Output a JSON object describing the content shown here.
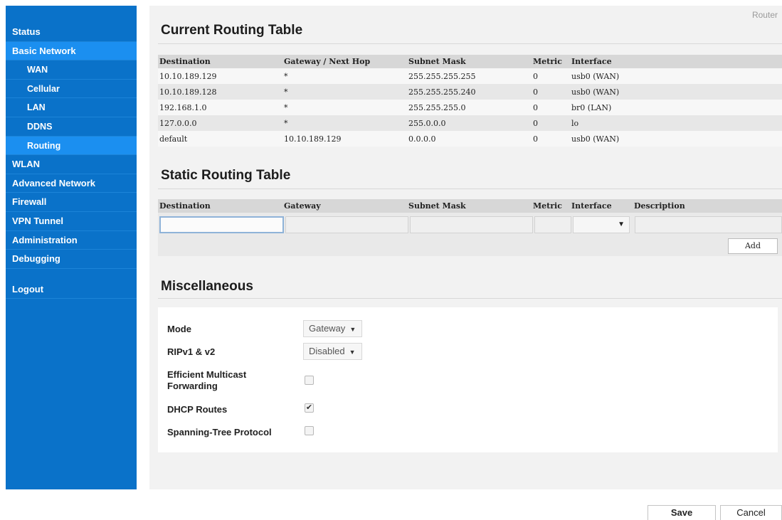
{
  "breadcrumb": "Router",
  "sidebar": {
    "items": [
      {
        "label": "Status"
      },
      {
        "label": "Basic Network"
      },
      {
        "label": "WAN"
      },
      {
        "label": "Cellular"
      },
      {
        "label": "LAN"
      },
      {
        "label": "DDNS"
      },
      {
        "label": "Routing"
      },
      {
        "label": "WLAN"
      },
      {
        "label": "Advanced Network"
      },
      {
        "label": "Firewall"
      },
      {
        "label": "VPN Tunnel"
      },
      {
        "label": "Administration"
      },
      {
        "label": "Debugging"
      },
      {
        "label": "Logout"
      }
    ]
  },
  "current_routing": {
    "title": "Current Routing Table",
    "headers": [
      "Destination",
      "Gateway / Next Hop",
      "Subnet Mask",
      "Metric",
      "Interface"
    ],
    "rows": [
      [
        "10.10.189.129",
        "*",
        "255.255.255.255",
        "0",
        "usb0 (WAN)"
      ],
      [
        "10.10.189.128",
        "*",
        "255.255.255.240",
        "0",
        "usb0 (WAN)"
      ],
      [
        "192.168.1.0",
        "*",
        "255.255.255.0",
        "0",
        "br0 (LAN)"
      ],
      [
        "127.0.0.0",
        "*",
        "255.0.0.0",
        "0",
        "lo"
      ],
      [
        "default",
        "10.10.189.129",
        "0.0.0.0",
        "0",
        "usb0 (WAN)"
      ]
    ]
  },
  "static_routing": {
    "title": "Static Routing Table",
    "headers": [
      "Destination",
      "Gateway",
      "Subnet Mask",
      "Metric",
      "Interface",
      "Description"
    ],
    "add_label": "Add"
  },
  "misc": {
    "title": "Miscellaneous",
    "mode_label": "Mode",
    "mode_value": "Gateway",
    "rip_label": "RIPv1 & v2",
    "rip_value": "Disabled",
    "multicast_label_1": "Efficient Multicast",
    "multicast_label_2": "Forwarding",
    "multicast_checked": false,
    "dhcp_label": "DHCP Routes",
    "dhcp_checked": true,
    "stp_label": "Spanning-Tree Protocol",
    "stp_checked": false
  },
  "footer": {
    "save_label": "Save",
    "cancel_label": "Cancel"
  },
  "colors": {
    "sidebar": "#0a72c9",
    "sidebar_active": "#1b8ff0",
    "panel": "#f2f2f2"
  }
}
